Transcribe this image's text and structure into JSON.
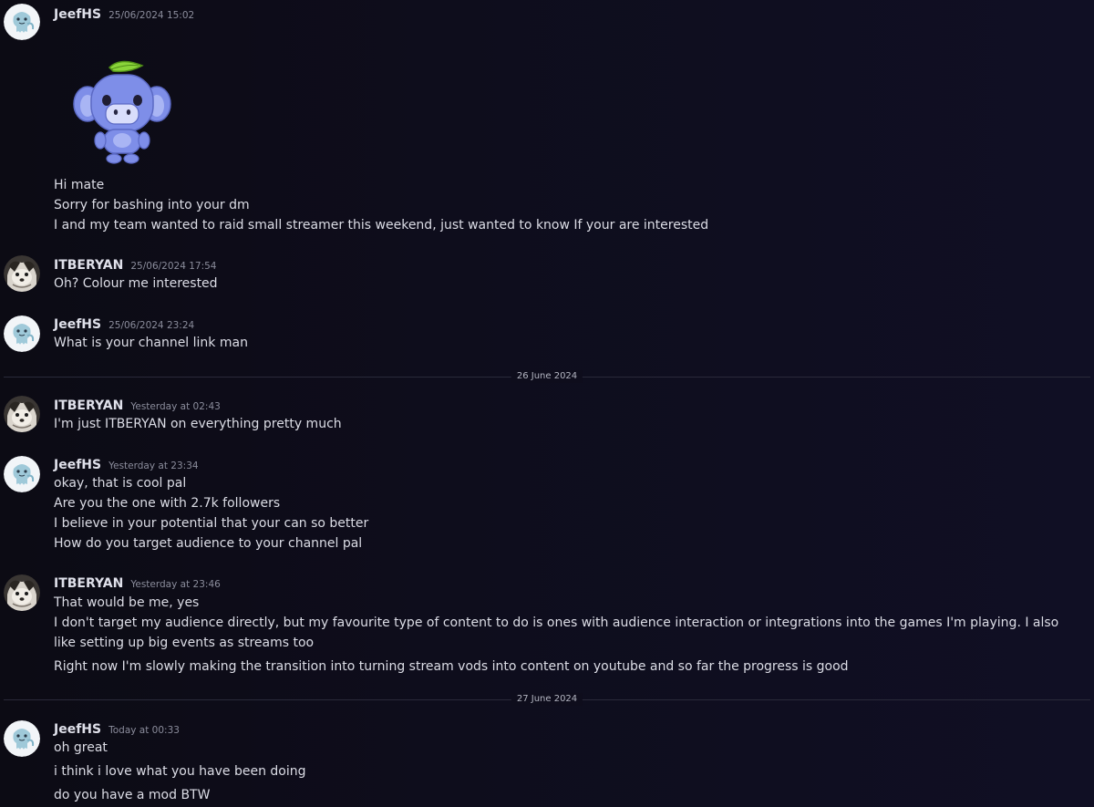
{
  "colors": {
    "background": "#0d0c17",
    "username": "#dfe0ea",
    "timestamp": "#8b8d9c",
    "text": "#dcdde6",
    "divider": "#2a2a3a",
    "wumpus_body": "#7e8ee8",
    "leaf": "#8ad43a"
  },
  "messages": [
    {
      "author": "JeefHS",
      "timestamp": "25/06/2024 15:02",
      "avatar_icon": "squid-avatar-icon",
      "sticker": "wumpus-sticker-icon",
      "lines": [
        "Hi mate",
        "Sorry for bashing into your dm",
        "I and my team wanted to raid small streamer this weekend, just wanted to know If your are interested"
      ]
    },
    {
      "author": "ITBERYAN",
      "timestamp": "25/06/2024 17:54",
      "avatar_icon": "dog-avatar-icon",
      "lines": [
        "Oh? Colour me interested"
      ]
    },
    {
      "author": "JeefHS",
      "timestamp": "25/06/2024 23:24",
      "avatar_icon": "squid-avatar-icon",
      "lines": [
        "What is your channel link man"
      ]
    },
    {
      "author": "ITBERYAN",
      "timestamp": "Yesterday at 02:43",
      "avatar_icon": "dog-avatar-icon",
      "lines": [
        "I'm just ITBERYAN on everything pretty much"
      ]
    },
    {
      "author": "JeefHS",
      "timestamp": "Yesterday at 23:34",
      "avatar_icon": "squid-avatar-icon",
      "lines": [
        "okay, that is cool pal",
        "Are you the one with 2.7k followers",
        "I believe in your potential that your can so better",
        "How do you target audience to your channel pal"
      ]
    },
    {
      "author": "ITBERYAN",
      "timestamp": "Yesterday at 23:46",
      "avatar_icon": "dog-avatar-icon",
      "lines": [
        "That would be me, yes",
        "I don't target my audience directly, but my favourite type of content to do is ones with audience interaction or integrations into the games I'm playing. I also like setting up big events as streams too",
        "Right now I'm slowly making the transition into turning stream vods into content on youtube and so far the progress is good"
      ]
    },
    {
      "author": "JeefHS",
      "timestamp": "Today at 00:33",
      "avatar_icon": "squid-avatar-icon",
      "lines": [
        "oh great",
        "i think i love what you have been doing",
        "do you have a mod BTW"
      ]
    }
  ],
  "dividers": [
    "26 June 2024",
    "27 June 2024"
  ]
}
